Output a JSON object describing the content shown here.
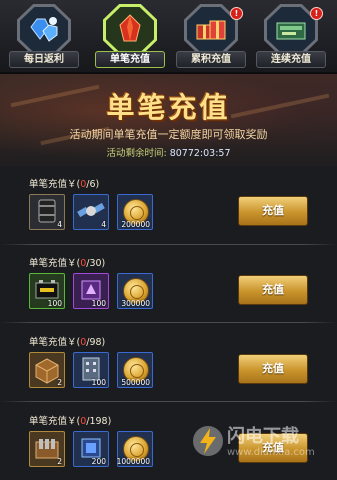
{
  "tabs": [
    {
      "label": "每日返利",
      "alert": false,
      "art": "gems-icon",
      "color": "#2b6fd8"
    },
    {
      "label": "单笔充值",
      "alert": false,
      "art": "red-crystal-icon",
      "color": "#d83a2a"
    },
    {
      "label": "累积充值",
      "alert": true,
      "art": "gift-boxes-icon",
      "color": "#c8463a"
    },
    {
      "label": "连续充值",
      "alert": true,
      "art": "weapon-crate-icon",
      "color": "#3c8a5a"
    }
  ],
  "alert_mark": "!",
  "banner": {
    "title": "单笔充值",
    "subtitle": "活动期间单笔充值一定额度即可领取奖励",
    "timer_label": "活动剩余时间:",
    "timer_value": "80772:03:57"
  },
  "sections": [
    {
      "title_prefix": "单笔充值￥(",
      "current": "0",
      "target": "/6)",
      "button": "充值",
      "items": [
        {
          "name": "oil-barrel-icon",
          "qty": "4",
          "rarity": "plain"
        },
        {
          "name": "satellite-icon",
          "qty": "4",
          "rarity": "blue"
        },
        {
          "name": "gold-coin-icon",
          "qty": "200000",
          "rarity": "blue"
        }
      ]
    },
    {
      "title_prefix": "单笔充值￥(",
      "current": "0",
      "target": "/30)",
      "button": "充值",
      "items": [
        {
          "name": "battery-icon",
          "qty": "100",
          "rarity": "green"
        },
        {
          "name": "purple-chip-icon",
          "qty": "100",
          "rarity": "purple"
        },
        {
          "name": "gold-coin-icon",
          "qty": "300000",
          "rarity": "blue"
        }
      ]
    },
    {
      "title_prefix": "单笔充值￥(",
      "current": "0",
      "target": "/98)",
      "button": "充值",
      "items": [
        {
          "name": "supply-crate-icon",
          "qty": "2",
          "rarity": "gold"
        },
        {
          "name": "building-icon",
          "qty": "100",
          "rarity": "blue"
        },
        {
          "name": "gold-coin-icon",
          "qty": "500000",
          "rarity": "blue"
        }
      ]
    },
    {
      "title_prefix": "单笔充值￥(",
      "current": "0",
      "target": "/198)",
      "button": "充值",
      "items": [
        {
          "name": "ammo-crate-icon",
          "qty": "2",
          "rarity": "gold"
        },
        {
          "name": "blue-chip-icon",
          "qty": "200",
          "rarity": "blue"
        },
        {
          "name": "gold-coin-icon",
          "qty": "1000000",
          "rarity": "blue"
        }
      ]
    }
  ],
  "watermark": {
    "text": "闪电下载",
    "url": "www.dianxia.com"
  }
}
